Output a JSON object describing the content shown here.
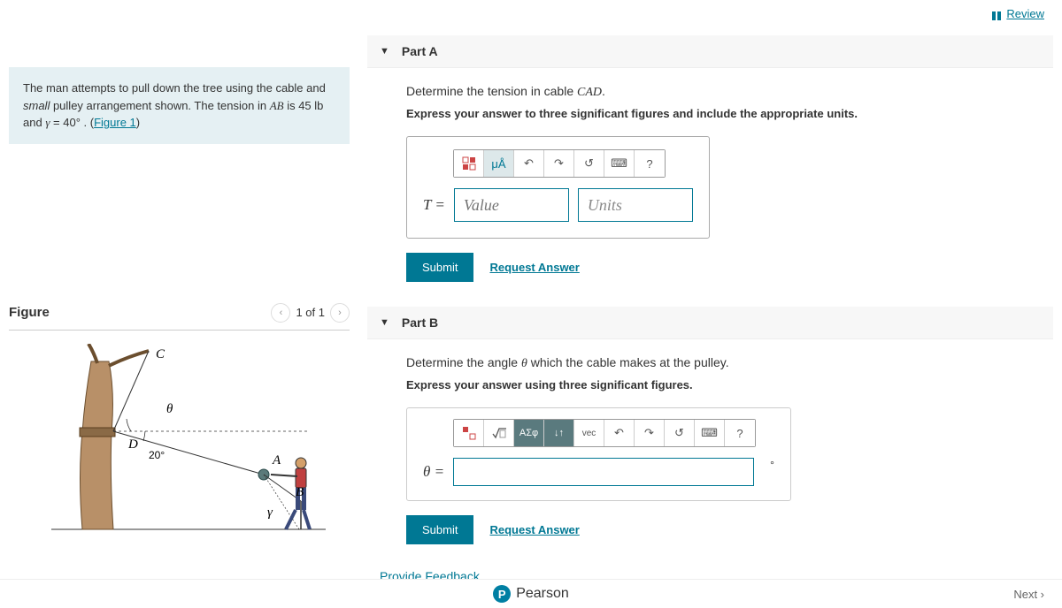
{
  "header": {
    "review": "Review"
  },
  "problem": {
    "text1": "The man attempts to pull down the tree using the cable and ",
    "small": "small",
    "text2": " pulley arrangement shown. The tension in ",
    "ab": "AB",
    "text3": " is 45  lb and ",
    "gamma": "γ",
    "text4": " = 40° . (",
    "figlink": "Figure 1",
    "text5": ")"
  },
  "figure": {
    "title": "Figure",
    "counter": "1 of 1",
    "labels": {
      "C": "C",
      "D": "D",
      "A": "A",
      "B": "B",
      "theta": "θ",
      "gamma": "γ",
      "angle20": "20°"
    }
  },
  "partA": {
    "title": "Part A",
    "prompt1": "Determine the tension in cable ",
    "cad": "CAD",
    "prompt2": ".",
    "instruction": "Express your answer to three significant figures and include the appropriate units.",
    "var": "T = ",
    "value_ph": "Value",
    "units_ph": "Units",
    "toolbar": {
      "units": "μÅ",
      "undo": "↶",
      "redo": "↷",
      "reset": "↺",
      "keyboard": "⌨",
      "help": "?"
    },
    "submit": "Submit",
    "request": "Request Answer"
  },
  "partB": {
    "title": "Part B",
    "prompt1": "Determine the angle ",
    "theta": "θ",
    "prompt2": " which the cable makes at the pulley.",
    "instruction": "Express your answer using three significant figures.",
    "var": "θ = ",
    "toolbar": {
      "greek": "ΑΣφ",
      "swap": "↓↑",
      "vec": "vec",
      "undo": "↶",
      "redo": "↷",
      "reset": "↺",
      "keyboard": "⌨",
      "help": "?"
    },
    "submit": "Submit",
    "request": "Request Answer"
  },
  "feedback": "Provide Feedback",
  "footer": {
    "brand": "Pearson",
    "next": "Next ›"
  }
}
